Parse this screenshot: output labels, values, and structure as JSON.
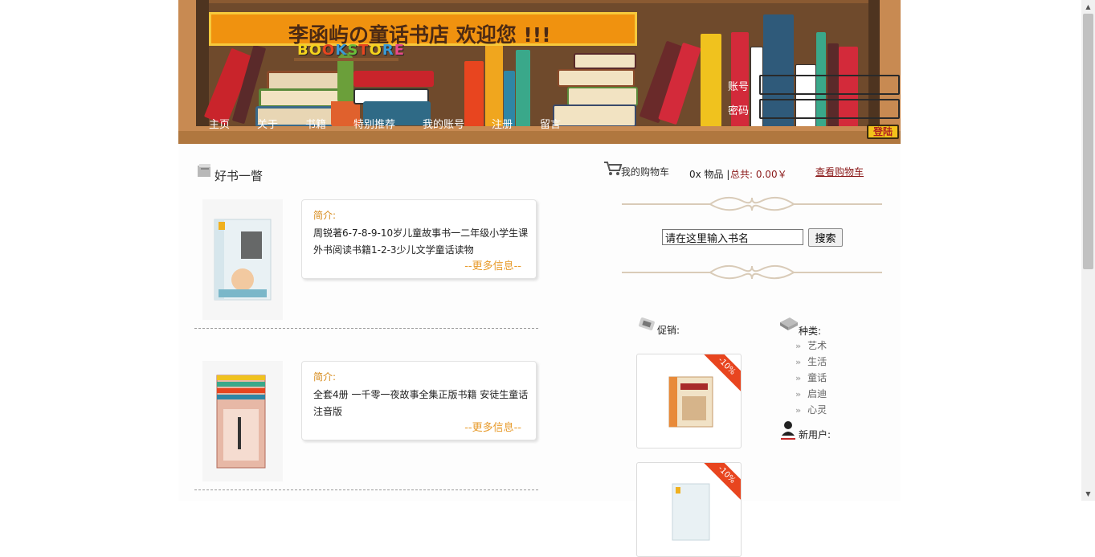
{
  "header": {
    "title": "李函屿の童话书店 欢迎您 !!!",
    "logo_letters": [
      "B",
      "O",
      "O",
      "K",
      "S",
      "T",
      "O",
      "R",
      "E"
    ],
    "nav": [
      "主页",
      "关于",
      "书籍",
      "特别推荐",
      "我的账号",
      "注册",
      "留言"
    ],
    "login": {
      "account_label": "账号",
      "password_label": "密码",
      "button_label": "登陆"
    }
  },
  "left": {
    "heading": "好书一瞥",
    "books": [
      {
        "intro_label": "简介:",
        "description": "周锐著6-7-8-9-10岁儿童故事书一二年级小学生课外书阅读书籍1-2-3少儿文学童话读物",
        "more": "--更多信息--"
      },
      {
        "intro_label": "简介:",
        "description": "全套4册 一千零一夜故事全集正版书籍 安徒生童话注音版",
        "more": "--更多信息--"
      }
    ]
  },
  "cart": {
    "label": "我的购物车",
    "count_text": "0x 物品 |",
    "total_text": "总共: 0.00￥",
    "view_link": "查看购物车"
  },
  "search": {
    "placeholder": "请在这里输入书名",
    "value": "请在这里输入书名",
    "button": "搜索"
  },
  "promo": {
    "label": "促销:",
    "badges": [
      "-10%",
      "-10%"
    ]
  },
  "categories": {
    "label": "种类:",
    "items": [
      "艺术",
      "生活",
      "童话",
      "启迪",
      "心灵"
    ]
  },
  "new_users": {
    "label": "新用户:"
  },
  "colors": {
    "accent": "#f0920f",
    "link": "#8b1a1a",
    "intro": "#d68a1a",
    "more": "#e79a2a",
    "badge": "#e8451f"
  }
}
